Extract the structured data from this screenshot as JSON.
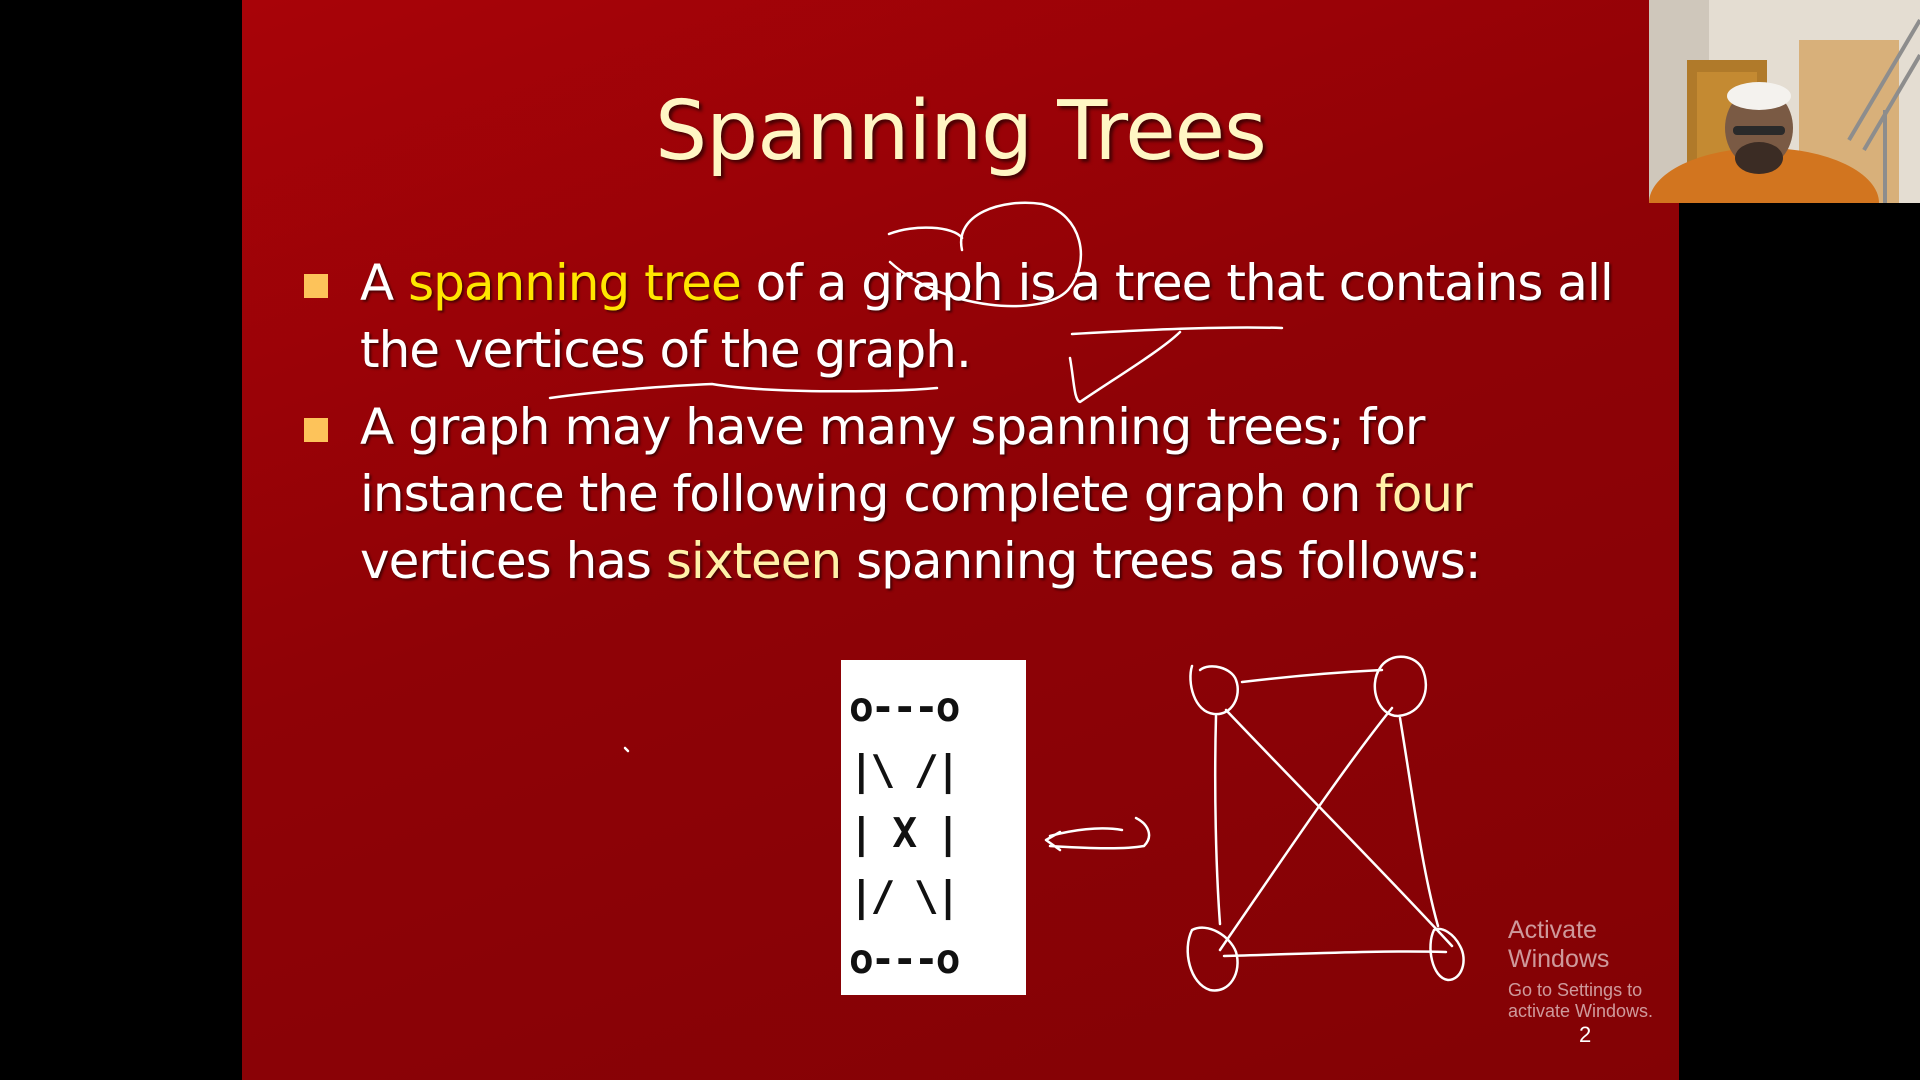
{
  "slide": {
    "title": "Spanning Trees",
    "bullets": [
      {
        "segments": [
          {
            "text": "A ",
            "style": "normal"
          },
          {
            "text": "spanning tree",
            "style": "highlight-yellow"
          },
          {
            "text": " of a graph is a tree that contains all the vertices of the graph.",
            "style": "normal"
          }
        ]
      },
      {
        "segments": [
          {
            "text": "A graph may have many spanning trees; for instance the following complete graph on ",
            "style": "normal"
          },
          {
            "text": "four",
            "style": "highlight-cream"
          },
          {
            "text": " vertices has ",
            "style": "normal"
          },
          {
            "text": "sixteen",
            "style": "highlight-cream"
          },
          {
            "text": " spanning trees as follows:",
            "style": "normal"
          }
        ]
      }
    ],
    "ascii_graph": "o---o\n|\\ /|\n| X |\n|/ \\|\no---o",
    "page_number": "2"
  },
  "watermark": {
    "title": "Activate Windows",
    "subtitle": "Go to Settings to activate Windows."
  },
  "colors": {
    "slide_background": "#9a0308",
    "title": "#fff6c4",
    "highlight_yellow": "#ffe600",
    "highlight_cream": "#fff0a8",
    "bullet_marker": "#fdc35a"
  }
}
